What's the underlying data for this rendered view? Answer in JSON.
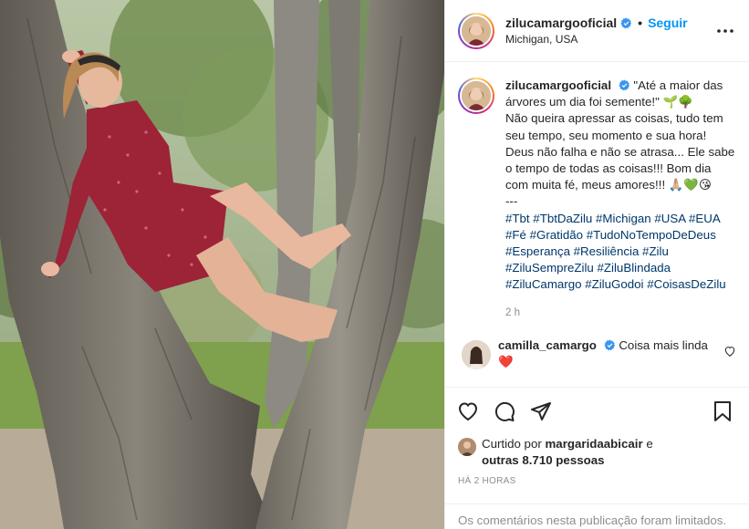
{
  "post": {
    "username": "zilucamargooficial",
    "follow_label": "Seguir",
    "location": "Michigan, USA",
    "more_label": "•••"
  },
  "caption": {
    "username": "zilucamargooficial",
    "text_lines": [
      "\"Até a maior das",
      "árvores um dia foi semente!\" 🌱🌳",
      "Não queira apressar as coisas, tudo tem",
      "seu tempo, seu momento e sua hora!",
      "Deus não falha e não se atrasa... Ele sabe",
      "o tempo de todas as coisas!!! Bom dia",
      "com muita fé, meus amores!!! 🙏🏼💚😘",
      "---"
    ],
    "hashtag_lines": [
      "#Tbt #TbtDaZilu #Michigan #USA #EUA",
      "#Fé #Gratidão #TudoNoTempoDeDeus",
      "#Esperança #Resiliência #Zilu",
      "#ZiluSempreZilu #ZiluBlindada",
      "#ZiluCamargo #ZiluGodoi #CoisasDeZilu"
    ],
    "time": "2 h"
  },
  "comment": {
    "username": "camilla_camargo",
    "text": "Coisa mais linda",
    "emoji": "❤️"
  },
  "likes": {
    "prefix": "Curtido por",
    "user": "margaridaabicair",
    "connector": "e",
    "others": "outras 8.710 pessoas"
  },
  "timestamp": "HÁ 2 HORAS",
  "limited_notice": "Os comentários nesta publicação foram limitados.",
  "colors": {
    "accent": "#0095f6",
    "hashtag": "#00376b",
    "muted": "#8e8e8e",
    "verified": "#3897f0"
  }
}
